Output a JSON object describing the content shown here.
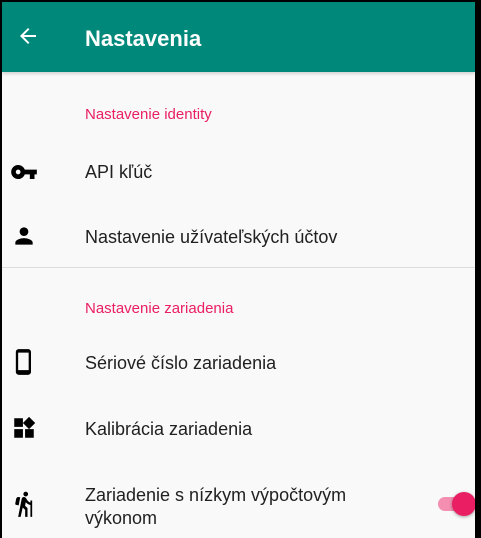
{
  "appbar": {
    "title": "Nastavenia",
    "back_icon": "arrow-left-icon"
  },
  "sections": [
    {
      "header": "Nastavenie identity",
      "items": [
        {
          "label": "API kľúč",
          "icon": "key-icon"
        },
        {
          "label": "Nastavenie užívateľských účtov",
          "icon": "person-icon"
        }
      ]
    },
    {
      "header": "Nastavenie zariadenia",
      "items": [
        {
          "label": "Sériové číslo zariadenia",
          "icon": "phone-icon"
        },
        {
          "label": "Kalibrácia zariadenia",
          "icon": "widgets-icon"
        },
        {
          "label": "Zariadenie s nízkym výpočtovým výkonom",
          "label_line1": "Zariadenie s nízkym výpočtovým",
          "label_line2": "výkonom",
          "icon": "hiking-icon",
          "toggle_on": true
        }
      ]
    }
  ],
  "colors": {
    "appbar": "#00897b",
    "accent": "#e91e63",
    "toggle_track": "#f48fb1",
    "text": "#212121"
  }
}
